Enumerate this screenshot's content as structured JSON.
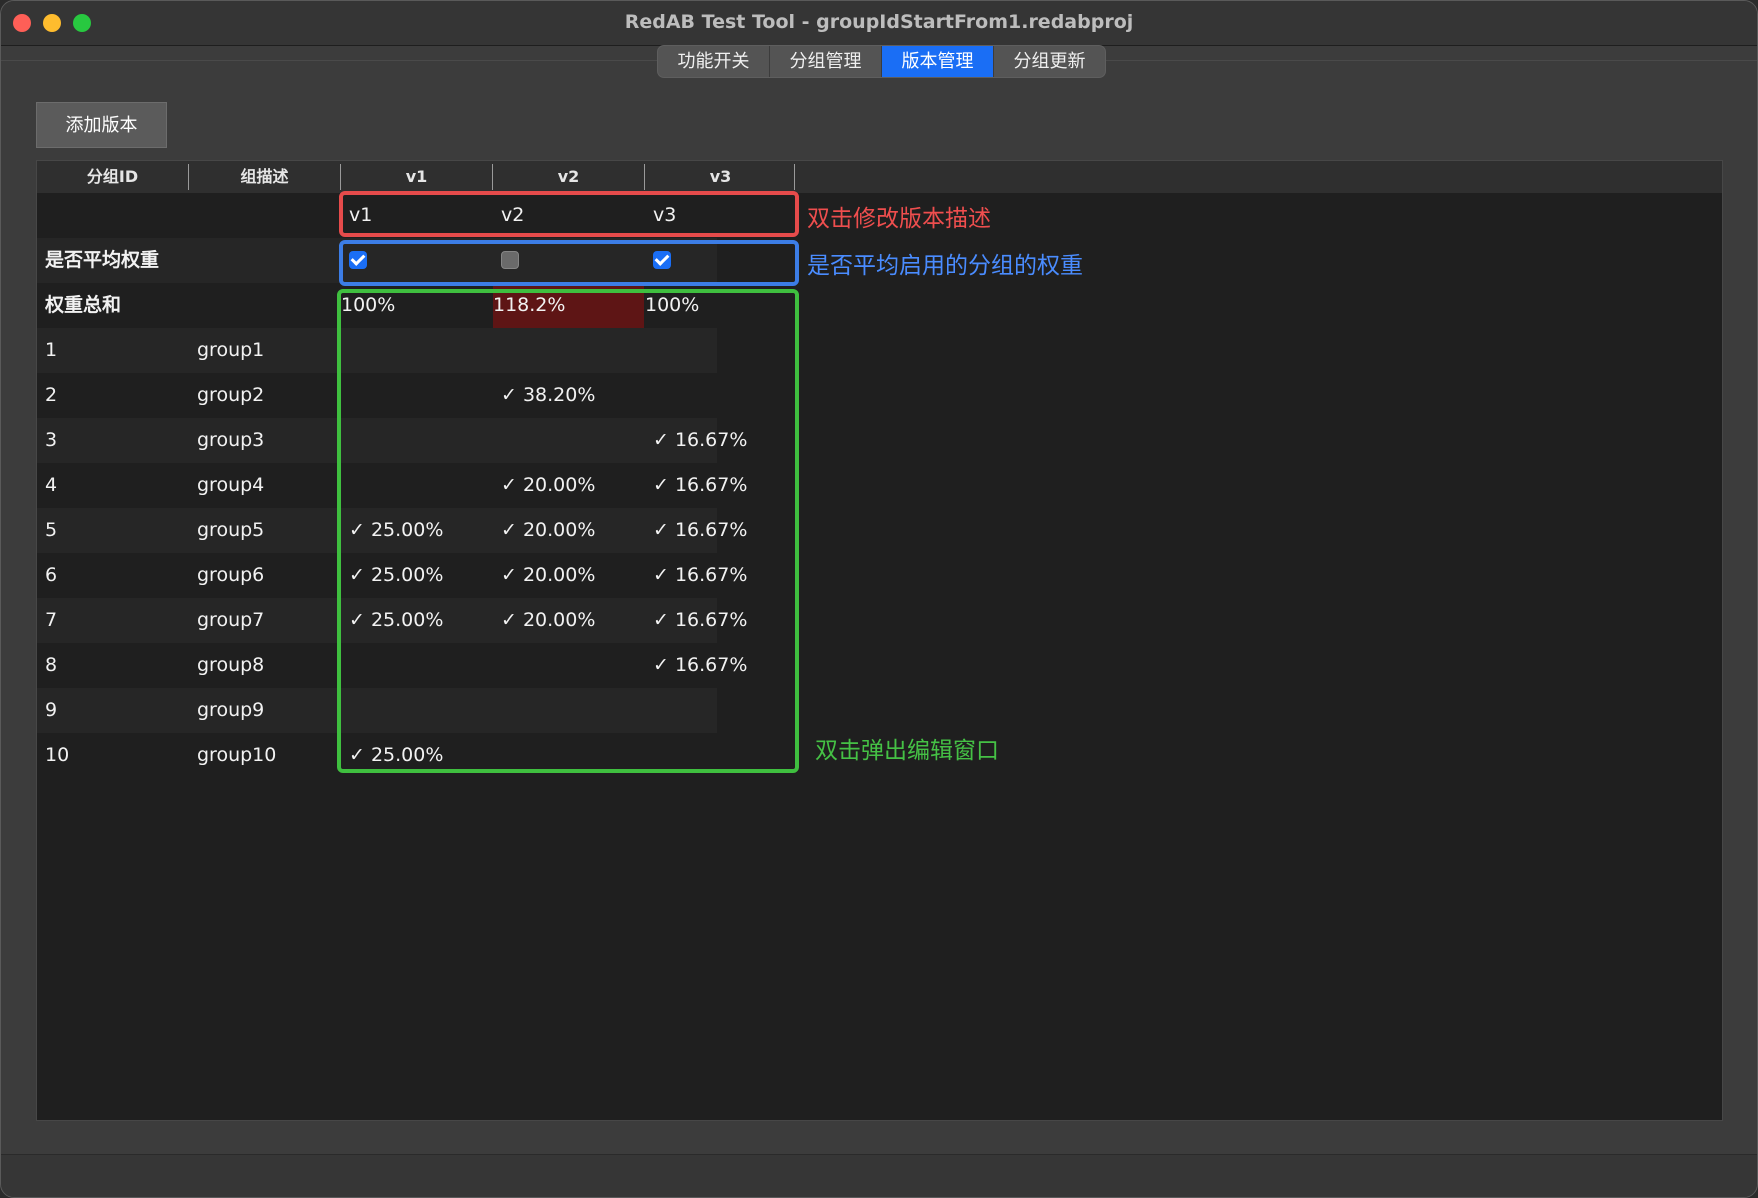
{
  "window": {
    "title": "RedAB Test Tool - groupIdStartFrom1.redabproj"
  },
  "tabs": [
    {
      "label": "功能开关",
      "active": false
    },
    {
      "label": "分组管理",
      "active": false
    },
    {
      "label": "版本管理",
      "active": true
    },
    {
      "label": "分组更新",
      "active": false
    }
  ],
  "toolbar": {
    "add_version_label": "添加版本"
  },
  "table": {
    "headers": [
      "分组ID",
      "组描述",
      "v1",
      "v2",
      "v3"
    ],
    "description_row": [
      "",
      "",
      "v1",
      "v2",
      "v3"
    ],
    "average_row": {
      "label": "是否平均权重",
      "checks": [
        true,
        false,
        true
      ]
    },
    "total_row": {
      "label": "权重总和",
      "values": [
        "100%",
        "118.2%",
        "100%"
      ],
      "exceeded": [
        false,
        true,
        false
      ]
    },
    "rows": [
      {
        "id": "1",
        "desc": "group1",
        "v1": "",
        "v2": "",
        "v3": ""
      },
      {
        "id": "2",
        "desc": "group2",
        "v1": "",
        "v2": "✓ 38.20%",
        "v3": ""
      },
      {
        "id": "3",
        "desc": "group3",
        "v1": "",
        "v2": "",
        "v3": "✓ 16.67%"
      },
      {
        "id": "4",
        "desc": "group4",
        "v1": "",
        "v2": "✓ 20.00%",
        "v3": "✓ 16.67%"
      },
      {
        "id": "5",
        "desc": "group5",
        "v1": "✓ 25.00%",
        "v2": "✓ 20.00%",
        "v3": "✓ 16.67%"
      },
      {
        "id": "6",
        "desc": "group6",
        "v1": "✓ 25.00%",
        "v2": "✓ 20.00%",
        "v3": "✓ 16.67%"
      },
      {
        "id": "7",
        "desc": "group7",
        "v1": "✓ 25.00%",
        "v2": "✓ 20.00%",
        "v3": "✓ 16.67%"
      },
      {
        "id": "8",
        "desc": "group8",
        "v1": "",
        "v2": "",
        "v3": "✓ 16.67%"
      },
      {
        "id": "9",
        "desc": "group9",
        "v1": "",
        "v2": "",
        "v3": ""
      },
      {
        "id": "10",
        "desc": "group10",
        "v1": "✓ 25.00%",
        "v2": "",
        "v3": ""
      }
    ]
  },
  "annotations": {
    "description": "双击修改版本描述",
    "average": "是否平均启用的分组的权重",
    "edit": "双击弹出编辑窗口"
  },
  "colors": {
    "accent": "#1a6ef5",
    "exceeded_bg": "#5e1515",
    "annotation_red": "#ef4e4e",
    "annotation_blue": "#4a8cff",
    "annotation_green": "#45c145"
  }
}
